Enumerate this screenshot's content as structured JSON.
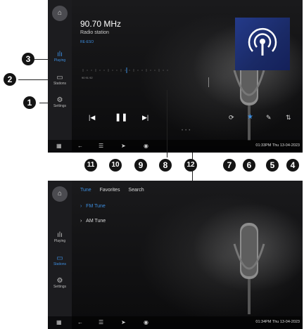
{
  "screen1": {
    "frequency": "90.70 MHz",
    "station": "Radio station",
    "rds": "RE-ESO",
    "sidebar": [
      {
        "label": "Playing",
        "icon": "equalizer-icon",
        "active": true
      },
      {
        "label": "Stations",
        "icon": "list-icon",
        "active": false
      },
      {
        "label": "Settings",
        "icon": "gear-icon",
        "active": false
      }
    ],
    "scale_numbers": "90   91   92",
    "controls": {
      "prev": "|◀",
      "play_pause": "❚❚",
      "next": "▶|",
      "search": "⟳",
      "favorite": "★",
      "edit": "✎",
      "eq": "⇅"
    },
    "status": "01:33PM Thu 13-04-2023"
  },
  "screen2": {
    "tabs": [
      "Tune",
      "Favorites",
      "Search"
    ],
    "items": [
      {
        "label": "FM Tune",
        "active": true
      },
      {
        "label": "AM Tune",
        "active": false
      }
    ],
    "sidebar": [
      {
        "label": "Playing",
        "icon": "equalizer-icon",
        "active": false
      },
      {
        "label": "Stations",
        "icon": "list-icon",
        "active": true
      },
      {
        "label": "Settings",
        "icon": "gear-icon",
        "active": false
      }
    ],
    "status": "01:34PM Thu 13-04-2023"
  },
  "bottom_bar": {
    "grid": "▦",
    "back": "←",
    "sliders": "☰",
    "nav": "➤",
    "camera": "◉"
  },
  "callouts": [
    "1",
    "2",
    "3",
    "4",
    "5",
    "6",
    "7",
    "8",
    "9",
    "10",
    "11",
    "12"
  ]
}
